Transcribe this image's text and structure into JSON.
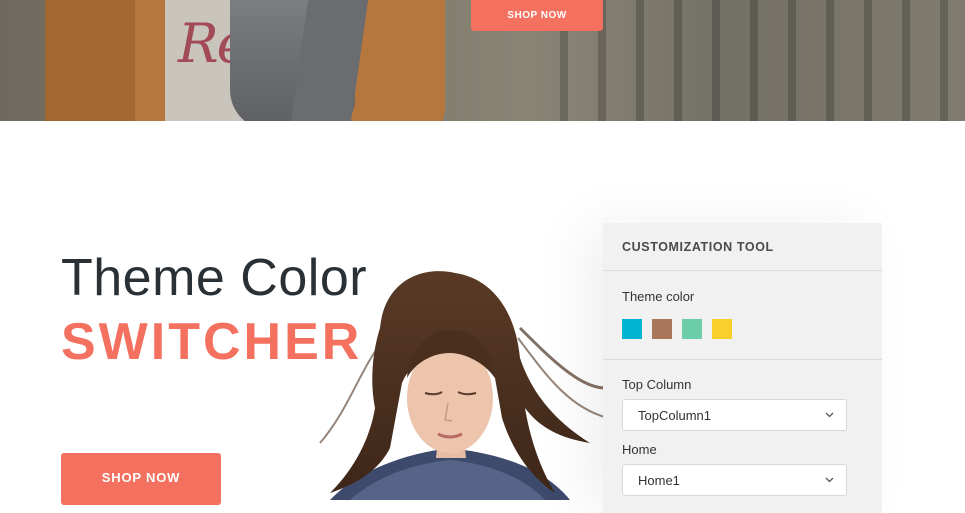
{
  "hero": {
    "shop_now_label": "SHOP NOW",
    "shirt_text": "Re"
  },
  "main": {
    "title_line1": "Theme Color",
    "title_line2": "SWITCHER",
    "shop_now_label": "SHOP NOW"
  },
  "customization": {
    "title": "CUSTOMIZATION TOOL",
    "theme_color_label": "Theme color",
    "swatches": [
      {
        "name": "cyan",
        "color": "#00b4d2"
      },
      {
        "name": "brown",
        "color": "#a9765a"
      },
      {
        "name": "mint",
        "color": "#6ccea9"
      },
      {
        "name": "yellow",
        "color": "#f9cf2b"
      }
    ],
    "top_column_label": "Top Column",
    "top_column_value": "TopColumn1",
    "home_label": "Home",
    "home_value": "Home1"
  },
  "colors": {
    "accent": "#f47160",
    "title_dark": "#2a3136"
  }
}
